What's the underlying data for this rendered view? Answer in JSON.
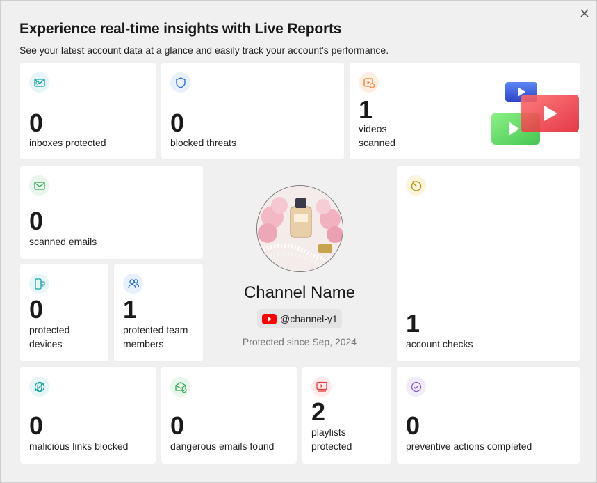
{
  "header": {
    "title": "Experience real-time insights with Live Reports",
    "subtitle": "See your latest account data at a glance and easily track your account's performance."
  },
  "stats": {
    "inboxes": {
      "value": "0",
      "label": "inboxes protected",
      "icon": "inbox-shield-icon"
    },
    "threats": {
      "value": "0",
      "label": "blocked threats",
      "icon": "shield-icon"
    },
    "videos": {
      "value": "1",
      "label_line1": "videos",
      "label_line2": "scanned",
      "icon": "video-check-icon"
    },
    "emails": {
      "value": "0",
      "label": "scanned emails",
      "icon": "envelope-icon"
    },
    "devices": {
      "value": "0",
      "label_line1": "protected",
      "label_line2": "devices",
      "icon": "devices-icon"
    },
    "team": {
      "value": "1",
      "label_line1": "protected team",
      "label_line2": "members",
      "icon": "team-icon"
    },
    "checks": {
      "value": "1",
      "label": "account checks",
      "icon": "timer-icon"
    },
    "links": {
      "value": "0",
      "label": "malicious links blocked",
      "icon": "blocked-link-icon"
    },
    "dangerous": {
      "value": "0",
      "label": "dangerous emails found",
      "icon": "mail-check-icon"
    },
    "playlists": {
      "value": "2",
      "label_line1": "playlists",
      "label_line2": "protected",
      "icon": "playlist-icon"
    },
    "preventive": {
      "value": "0",
      "label": "preventive actions completed",
      "icon": "check-circle-icon"
    }
  },
  "profile": {
    "name": "Channel Name",
    "handle": "@channel-y1",
    "since": "Protected since Sep, 2024"
  },
  "colors": {
    "teal": "#1aa3a3",
    "blue": "#2b6fd6",
    "orange": "#f07c2a",
    "green": "#2fa84f",
    "gold": "#b9950c",
    "red": "#e33a3a",
    "purple": "#8a5cc9",
    "youtube": "#ff0000"
  }
}
